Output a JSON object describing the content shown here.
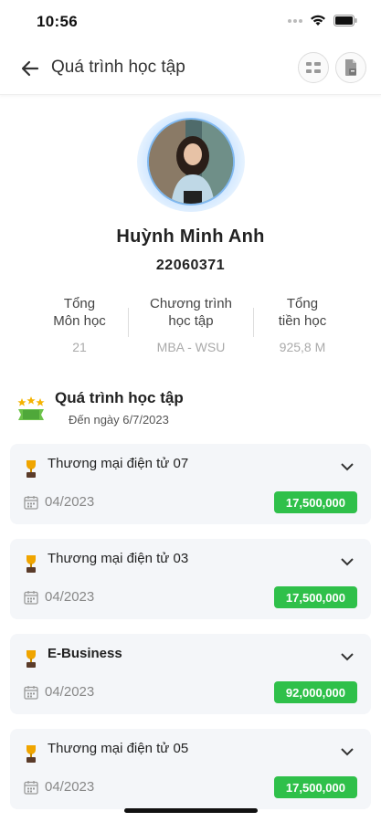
{
  "status_bar": {
    "time": "10:56"
  },
  "header": {
    "title": "Quá trình học tập"
  },
  "profile": {
    "name": "Huỳnh Minh Anh",
    "student_id": "22060371"
  },
  "stats": [
    {
      "label_line1": "Tổng",
      "label_line2": "Môn học",
      "value": "21"
    },
    {
      "label_line1": "Chương trình",
      "label_line2": "học tập",
      "value": "MBA - WSU"
    },
    {
      "label_line1": "Tổng",
      "label_line2": "tiền học",
      "value": "925,8 M"
    }
  ],
  "section": {
    "title": "Quá trình học tập",
    "subtitle": "Đến ngày 6/7/2023"
  },
  "courses": [
    {
      "name": "Thương mại điện tử 07",
      "date": "04/2023",
      "fee": "17,500,000"
    },
    {
      "name": "Thương mại điện tử 03",
      "date": "04/2023",
      "fee": "17,500,000"
    },
    {
      "name": "E-Business",
      "date": "04/2023",
      "fee": "92,000,000"
    },
    {
      "name": "Thương mại điện tử 05",
      "date": "04/2023",
      "fee": "17,500,000"
    }
  ],
  "colors": {
    "accent_green": "#2fc04a",
    "card_bg": "#f4f6f9",
    "avatar_ring": "#cfe6ff"
  },
  "icons": [
    "back-arrow-icon",
    "grid-icon",
    "document-icon",
    "stars-badge-icon",
    "trophy-icon",
    "chevron-down-icon",
    "calendar-icon"
  ]
}
